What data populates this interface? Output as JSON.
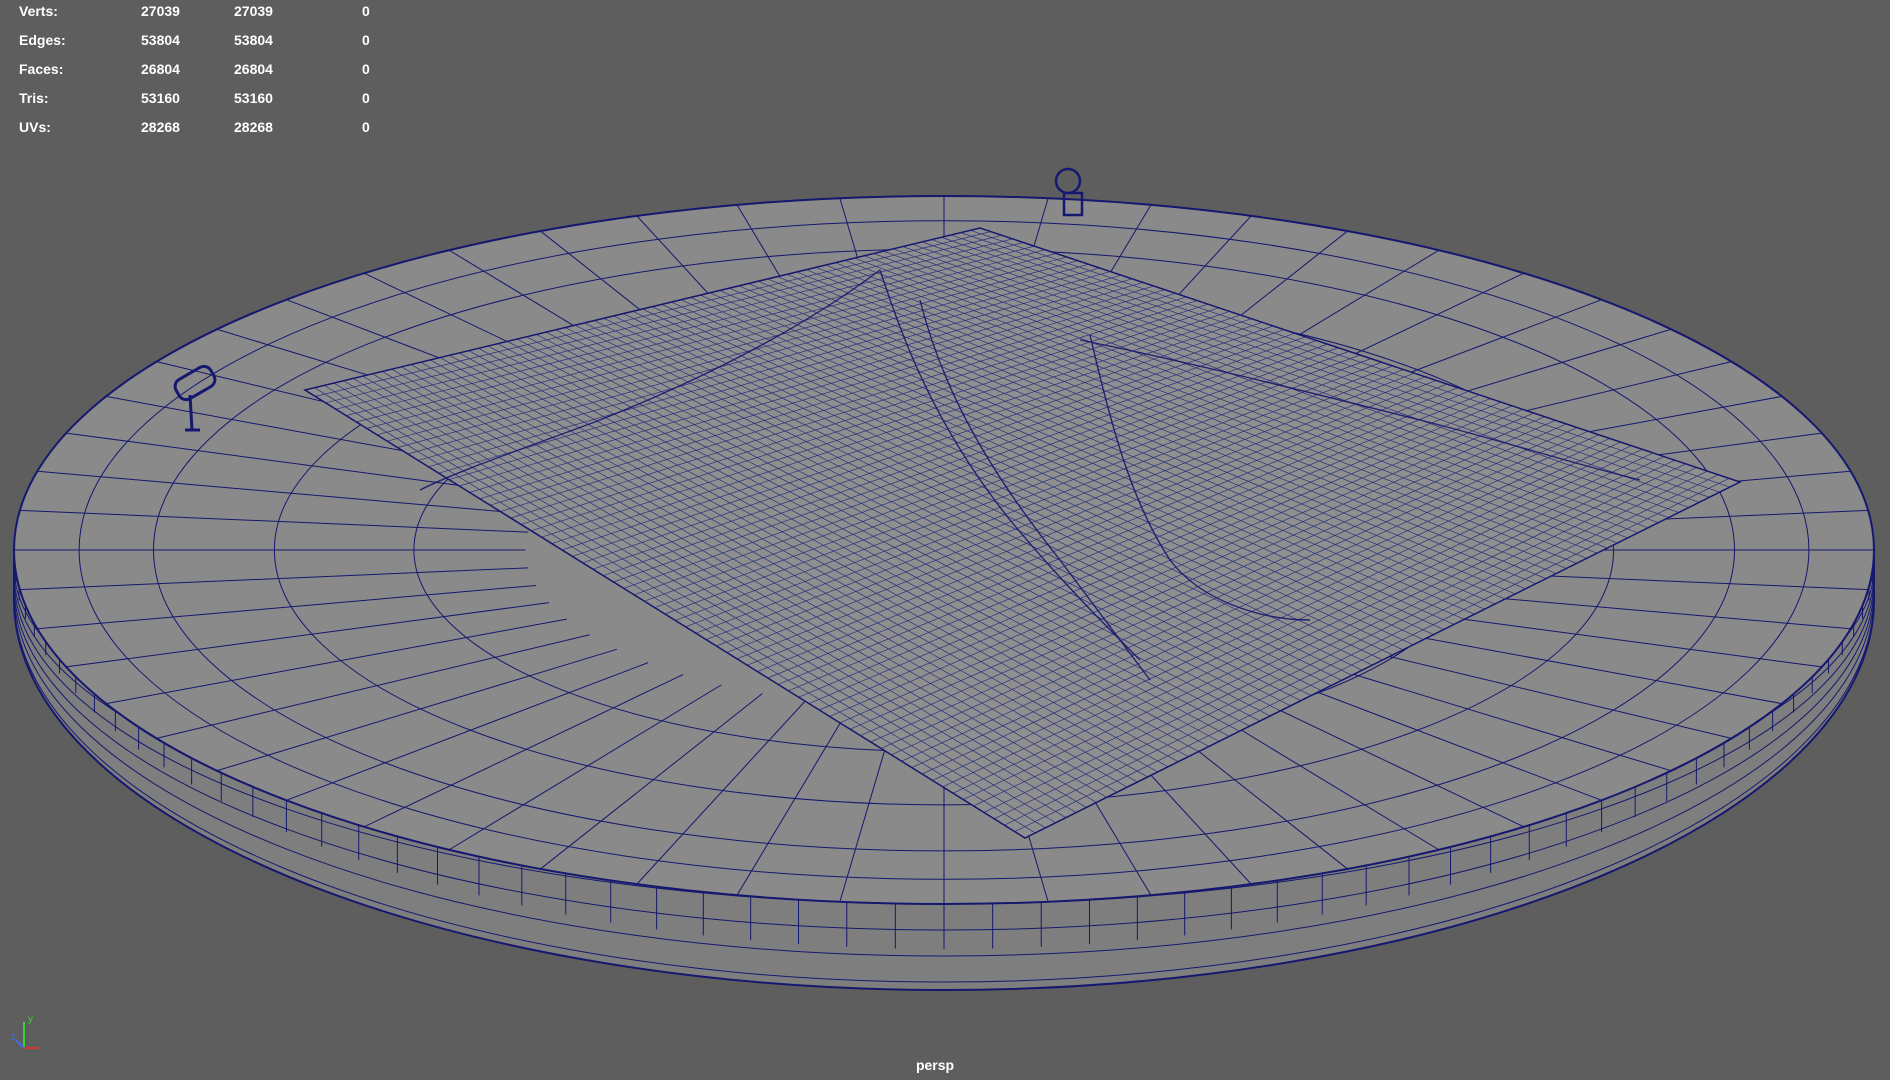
{
  "viewport": {
    "background": "#5e5e5e",
    "wire_color": "#15186e",
    "mesh_fill": "#888888",
    "camera": "persp"
  },
  "hud": {
    "rows": [
      {
        "label": "Verts:",
        "total": "27039",
        "selected": "27039",
        "extra": "0"
      },
      {
        "label": "Edges:",
        "total": "53804",
        "selected": "53804",
        "extra": "0"
      },
      {
        "label": "Faces:",
        "total": "26804",
        "selected": "26804",
        "extra": "0"
      },
      {
        "label": "Tris:",
        "total": "53160",
        "selected": "53160",
        "extra": "0"
      },
      {
        "label": "UVs:",
        "total": "28268",
        "selected": "28268",
        "extra": "0"
      }
    ]
  },
  "axis_gizmo": {
    "y": "y",
    "z": "z"
  }
}
